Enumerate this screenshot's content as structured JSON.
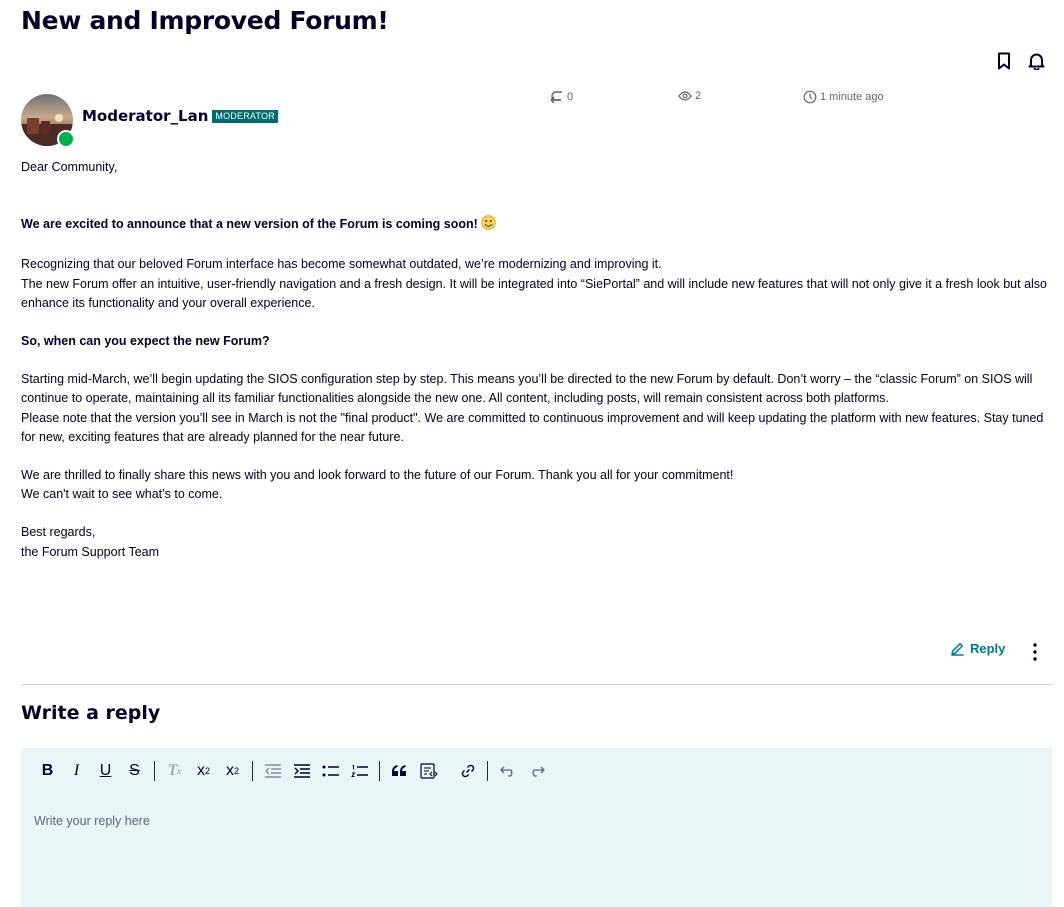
{
  "post": {
    "title": "New and Improved Forum!",
    "author": "Moderator_Lan",
    "role_badge": "MODERATOR",
    "replies": "0",
    "views": "2",
    "time": "1 minute ago"
  },
  "body": {
    "greeting": "Dear Community,",
    "announce": "We are excited to announce that a new version of the Forum is coming soon!",
    "p1_line1": "Recognizing that our beloved Forum interface has become somewhat outdated, we’re modernizing and improving it.",
    "p1_line2": "The new Forum offer an intuitive, user-friendly navigation and a fresh design. It will be integrated into “SiePortal” and will include new features that will not only give it a fresh look but also enhance its functionality and your overall experience.",
    "question": "So, when can you expect the new Forum?",
    "p2_line1": "Starting mid-March, we’ll begin updating the SIOS configuration step by step. This means you’ll be directed to the new Forum by default. Don’t worry – the “classic Forum” on SIOS will continue to operate, maintaining all its familiar functionalities alongside the new one. All content, including posts, will remain consistent across both platforms.",
    "p2_line2": "Please note that the version you’ll see in March is not the \"final product\". We are committed to continuous improvement and will keep updating the platform with new features. Stay tuned for new, exciting features that are already planned for the near future.",
    "p3_line1": "We are thrilled to finally share this news with you and look forward to the future of our Forum. Thank you all for your commitment!",
    "p3_line2": "We can't wait to see what’s to come.",
    "signoff1": "Best regards,",
    "signoff2": "the Forum Support Team"
  },
  "actions": {
    "reply_label": "Reply"
  },
  "reply_editor": {
    "heading": "Write a reply",
    "placeholder": "Write your reply here",
    "toolbar_icons": [
      "bold-icon",
      "italic-icon",
      "underline-icon",
      "strikethrough-icon",
      "clear-format-icon",
      "subscript-icon",
      "superscript-icon",
      "outdent-icon",
      "indent-icon",
      "bulleted-list-icon",
      "numbered-list-icon",
      "blockquote-icon",
      "code-block-icon",
      "link-icon",
      "undo-icon",
      "redo-icon"
    ]
  },
  "colors": {
    "accent": "#007993",
    "badge": "#006b6b",
    "online": "#00b050",
    "editor_bg": "#e9f5f7",
    "text": "#000028"
  }
}
